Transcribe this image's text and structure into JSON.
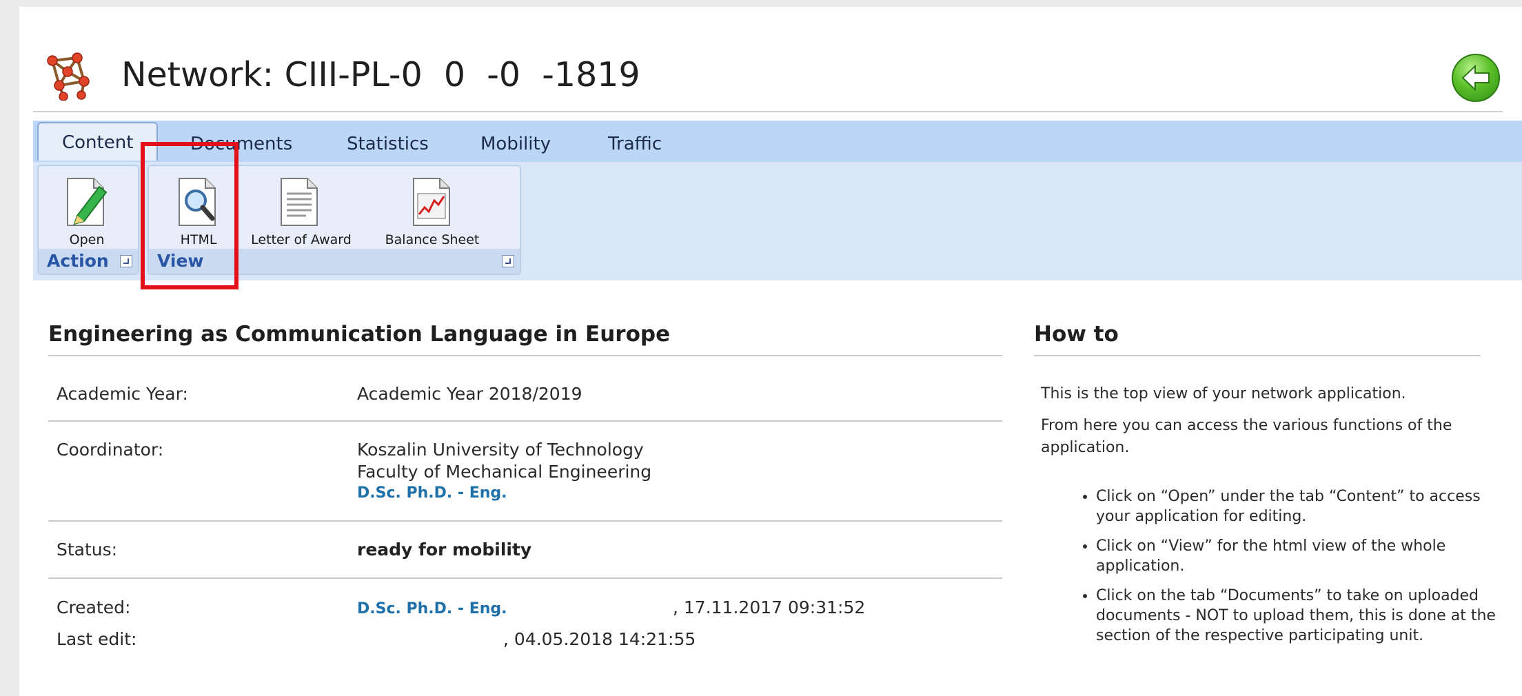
{
  "header": {
    "title": "Network: CIII-PL-0  0  -0  -1819",
    "app_icon": "molecule-icon",
    "back_icon": "back-arrow-icon"
  },
  "tabs": [
    {
      "label": "Content",
      "active": true
    },
    {
      "label": "Documents",
      "active": false
    },
    {
      "label": "Statistics",
      "active": false
    },
    {
      "label": "Mobility",
      "active": false
    },
    {
      "label": "Traffic",
      "active": false
    }
  ],
  "ribbon": {
    "action_group": {
      "label": "Action",
      "open_label": "Open"
    },
    "view_group": {
      "label": "View",
      "html_label": "HTML",
      "letter_label": "Letter of Award",
      "balance_label": "Balance Sheet"
    }
  },
  "main": {
    "title": "Engineering as Communication Language in Europe",
    "rows": {
      "academic_year_label": "Academic Year:",
      "academic_year_value": "Academic Year 2018/2019",
      "coordinator_label": "Coordinator:",
      "coordinator_line1": "Koszalin University of Technology",
      "coordinator_line2": "Faculty of Mechanical Engineering",
      "coordinator_person": "D.Sc. Ph.D. - Eng.",
      "status_label": "Status:",
      "status_value": "ready for mobility",
      "created_label": "Created:",
      "created_person": "D.Sc. Ph.D. - Eng.",
      "created_suffix": ", 17.11.2017 09:31:52",
      "last_edit_label": "Last edit:",
      "last_edit_suffix": ", 04.05.2018 14:21:55"
    }
  },
  "howto": {
    "title": "How to",
    "p1": "This is the top view of your network application.",
    "p2": "From here you can access the various functions of the application.",
    "items": [
      "Click on “Open” under the tab “Content” to access your application for editing.",
      "Click on “View” for the html view of the whole application.",
      "Click on the tab “Documents” to take on uploaded documents - NOT to upload them, this is done at the section of the respective participating unit."
    ]
  },
  "colors": {
    "ribbon_tabbar": "#bcd6f7",
    "group_label": "#2a56a6",
    "link": "#1f6fa8",
    "highlight": "#e3101b",
    "back_button": "#5cc02a"
  }
}
